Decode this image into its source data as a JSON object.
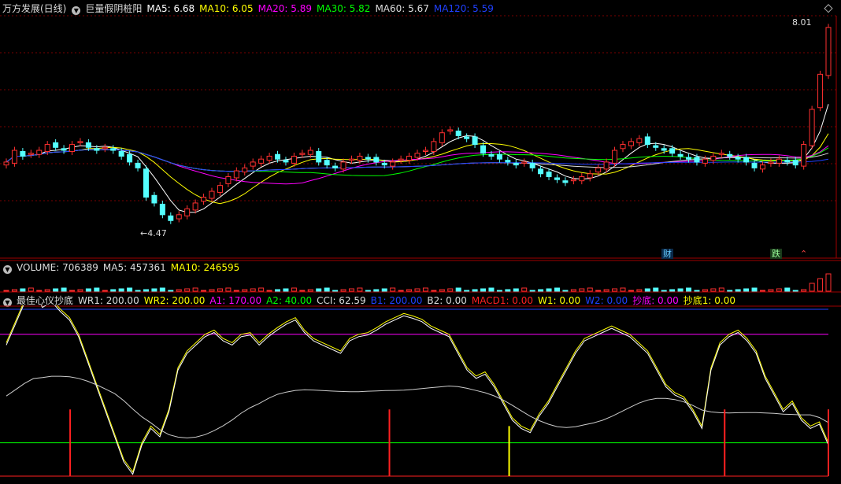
{
  "price_panel": {
    "stock_name": "万方发展(日线)",
    "indicator_name": "巨量假阴桩阳",
    "ma": [
      {
        "label": "MA5: 6.68",
        "color": "#ffffff"
      },
      {
        "label": "MA10: 6.05",
        "color": "#ffff00"
      },
      {
        "label": "MA20: 5.89",
        "color": "#ff00ff"
      },
      {
        "label": "MA30: 5.82",
        "color": "#00ff00"
      },
      {
        "label": "MA60: 5.67",
        "color": "#dddddd"
      },
      {
        "label": "MA120: 5.59",
        "color": "#2040ff"
      }
    ],
    "high_label": "8.01",
    "low_label": "4.47",
    "event_tags": {
      "finance": "财",
      "fall": "跌"
    }
  },
  "volume_panel": {
    "items": [
      {
        "label": "VOLUME: 706389",
        "color": "#dddddd"
      },
      {
        "label": "MA5: 457361",
        "color": "#dddddd"
      },
      {
        "label": "MA10: 246595",
        "color": "#ffff00"
      }
    ]
  },
  "indicator_panel": {
    "name": "最佳心仪抄底",
    "items": [
      {
        "label": "WR1: 200.00",
        "color": "#dddddd"
      },
      {
        "label": "WR2: 200.00",
        "color": "#ffff00"
      },
      {
        "label": "A1: 170.00",
        "color": "#ff00ff"
      },
      {
        "label": "A2: 40.00",
        "color": "#00ff00"
      },
      {
        "label": "CCI: 62.59",
        "color": "#dddddd"
      },
      {
        "label": "B1: 200.00",
        "color": "#2040ff"
      },
      {
        "label": "B2: 0.00",
        "color": "#dddddd"
      },
      {
        "label": "MACD1: 0.00",
        "color": "#ff2020"
      },
      {
        "label": "W1: 0.00",
        "color": "#ffff00"
      },
      {
        "label": "W2: 0.00",
        "color": "#2040ff"
      },
      {
        "label": "抄底: 0.00",
        "color": "#ff00ff"
      },
      {
        "label": "抄底1: 0.00",
        "color": "#ffff00"
      }
    ]
  },
  "chart_data": {
    "type": "candlestick",
    "closes": [
      5.7,
      5.9,
      5.8,
      5.85,
      5.9,
      6.0,
      5.95,
      5.9,
      6.0,
      6.05,
      5.95,
      5.9,
      5.95,
      5.9,
      5.8,
      5.7,
      5.6,
      5.1,
      5.0,
      4.8,
      4.7,
      4.8,
      4.9,
      5.0,
      5.1,
      5.2,
      5.3,
      5.45,
      5.55,
      5.6,
      5.7,
      5.75,
      5.8,
      5.75,
      5.7,
      5.8,
      5.85,
      5.9,
      5.7,
      5.65,
      5.6,
      5.7,
      5.75,
      5.8,
      5.75,
      5.7,
      5.65,
      5.7,
      5.75,
      5.8,
      5.85,
      5.9,
      6.05,
      6.2,
      6.25,
      6.15,
      6.1,
      6.0,
      5.85,
      5.8,
      5.75,
      5.7,
      5.65,
      5.7,
      5.6,
      5.5,
      5.45,
      5.4,
      5.35,
      5.4,
      5.45,
      5.5,
      5.6,
      5.7,
      5.9,
      6.0,
      6.05,
      6.1,
      6.0,
      5.95,
      5.9,
      5.85,
      5.8,
      5.75,
      5.7,
      5.75,
      5.8,
      5.85,
      5.8,
      5.75,
      5.7,
      5.6,
      5.65,
      5.7,
      5.75,
      5.7,
      5.65,
      6.0,
      6.6,
      7.2,
      8.0
    ],
    "wr_line": [
      160,
      185,
      210,
      225,
      205,
      212,
      200,
      190,
      170,
      140,
      110,
      80,
      50,
      20,
      5,
      40,
      60,
      50,
      80,
      130,
      150,
      160,
      170,
      175,
      165,
      160,
      170,
      172,
      160,
      170,
      178,
      185,
      190,
      175,
      165,
      160,
      155,
      150,
      165,
      170,
      172,
      178,
      185,
      190,
      195,
      192,
      188,
      180,
      175,
      170,
      150,
      130,
      120,
      125,
      110,
      90,
      70,
      60,
      55,
      75,
      90,
      110,
      130,
      150,
      165,
      170,
      175,
      180,
      175,
      170,
      160,
      150,
      130,
      110,
      100,
      95,
      80,
      60,
      130,
      160,
      170,
      175,
      165,
      150,
      120,
      100,
      80,
      90,
      70,
      60,
      65,
      40
    ],
    "red_signals": [
      8,
      48,
      90,
      103
    ],
    "yellow_signals": [
      63
    ],
    "price_range": [
      4.3,
      8.2
    ],
    "indicator_range": [
      0,
      200
    ]
  }
}
